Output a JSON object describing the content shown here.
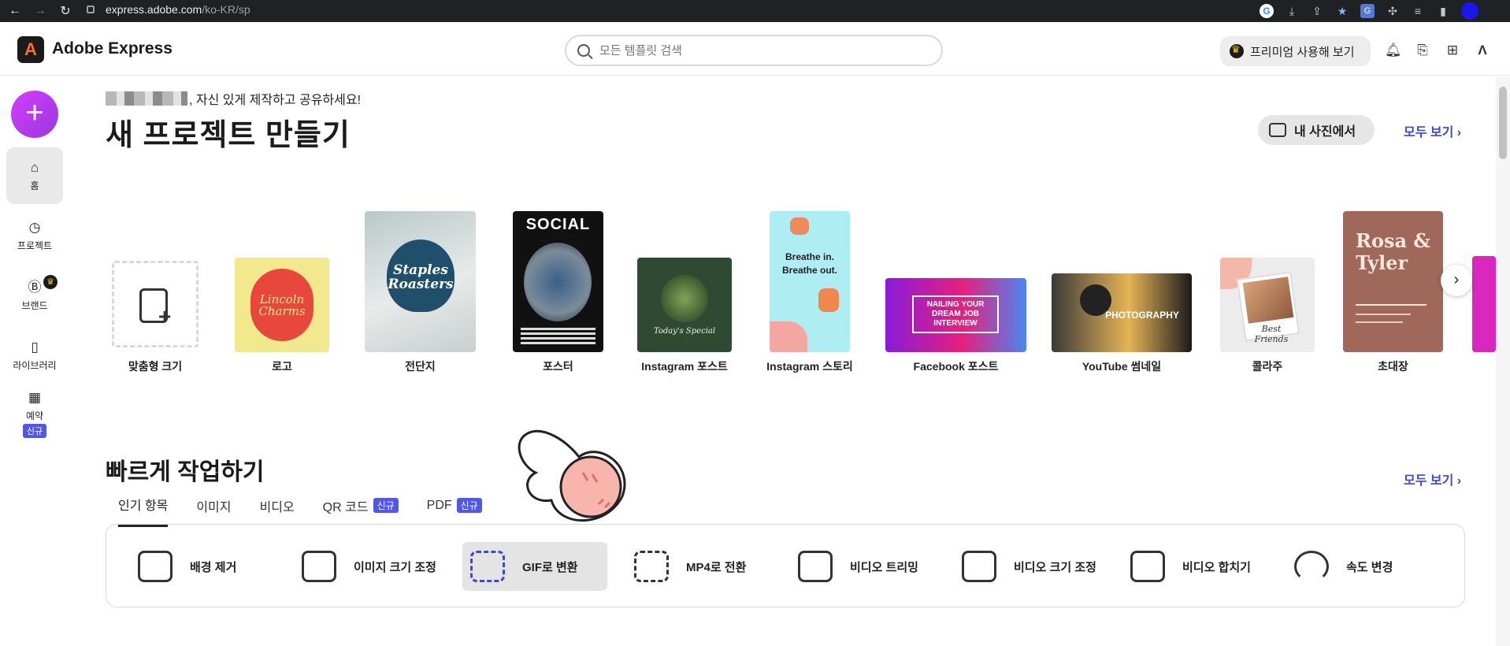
{
  "browser": {
    "url_host": "express.adobe.com",
    "url_path": "/ko-KR/sp"
  },
  "header": {
    "brand": "Adobe Express",
    "search_placeholder": "모든 템플릿 검색",
    "premium_label": "프리미엄 사용해 보기"
  },
  "sidebar": {
    "items": [
      {
        "label": "홈"
      },
      {
        "label": "프로젝트"
      },
      {
        "label": "브랜드"
      },
      {
        "label": "라이브러리"
      },
      {
        "label": "예약",
        "badge": "신규"
      }
    ]
  },
  "hero": {
    "greeting": ", 자신 있게 제작하고 공유하세요!",
    "title": "새 프로젝트 만들기",
    "photo_button": "내 사진에서",
    "see_all": "모두 보기 ›"
  },
  "templates": [
    {
      "label": "맞춤형 크기"
    },
    {
      "label": "로고",
      "text": "Lincoln Charms"
    },
    {
      "label": "전단지",
      "text": "Staples Roasters"
    },
    {
      "label": "포스터",
      "text": "SOCIAL"
    },
    {
      "label": "Instagram 포스트",
      "text": "Today's Special"
    },
    {
      "label": "Instagram 스토리",
      "text": "Breathe in. Breathe out."
    },
    {
      "label": "Facebook 포스트",
      "text": "NAILING YOUR DREAM JOB INTERVIEW"
    },
    {
      "label": "YouTube 썸네일",
      "text": "PHOTOGRAPHY"
    },
    {
      "label": "콜라주",
      "text": "Best Friends"
    },
    {
      "label": "초대장",
      "text": "Rosa & Tyler"
    }
  ],
  "quick": {
    "title": "빠르게 작업하기",
    "see_all": "모두 보기 ›",
    "tabs": [
      {
        "label": "인기 항목"
      },
      {
        "label": "이미지"
      },
      {
        "label": "비디오"
      },
      {
        "label": "QR 코드",
        "badge": "신규"
      },
      {
        "label": "PDF",
        "badge": "신규"
      }
    ],
    "actions": [
      {
        "label": "배경 제거"
      },
      {
        "label": "이미지 크기 조정"
      },
      {
        "label": "GIF로 변환"
      },
      {
        "label": "MP4로 전환"
      },
      {
        "label": "비디오 트리밍"
      },
      {
        "label": "비디오 크기 조정"
      },
      {
        "label": "비디오 합치기"
      },
      {
        "label": "속도 변경"
      }
    ]
  },
  "colors": {
    "accent": "#3d49c9",
    "badge": "#5258e4",
    "create": "#c13bf5"
  }
}
